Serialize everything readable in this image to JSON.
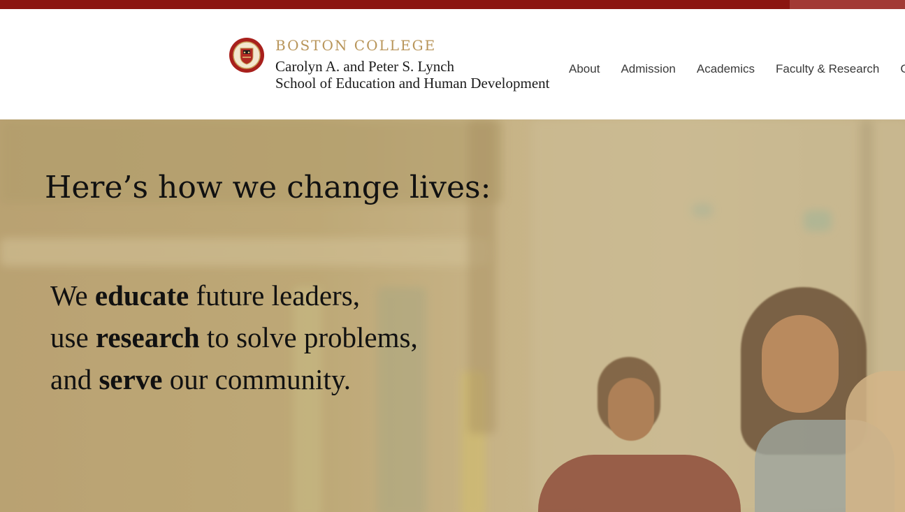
{
  "brand": {
    "college": "BOSTON COLLEGE",
    "school_line1": "Carolyn A. and Peter S. Lynch",
    "school_line2": "School of Education and Human Development"
  },
  "nav": {
    "items": [
      "About",
      "Admission",
      "Academics",
      "Faculty & Research",
      "C"
    ]
  },
  "hero": {
    "headline": "Here’s how we change lives:",
    "lines": [
      {
        "pre": "We ",
        "bold": "educate",
        "post": " future leaders,"
      },
      {
        "pre": "use ",
        "bold": "research",
        "post": " to solve problems,"
      },
      {
        "pre": "and ",
        "bold": "serve",
        "post": " our community."
      }
    ]
  },
  "colors": {
    "topbar": "#8b1510",
    "brand_gold": "#b8955a",
    "hero_tint": "#bba777"
  },
  "icons": {
    "seal": "boston-college-seal-icon"
  }
}
